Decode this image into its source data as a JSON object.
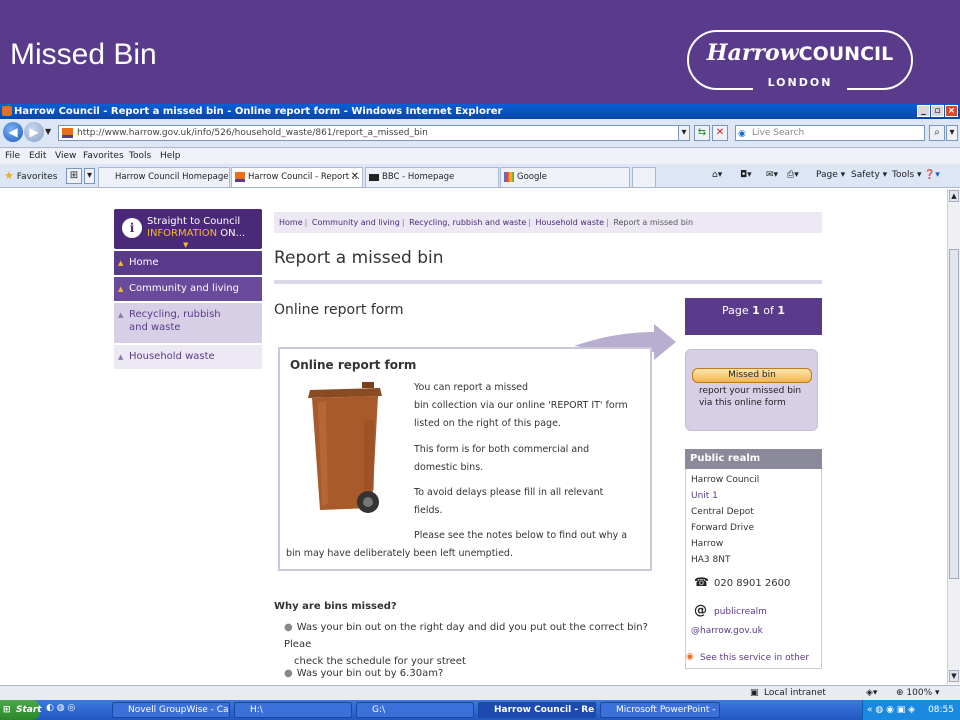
{
  "slide": {
    "title": "Missed Bin",
    "logo_main": "Harrow",
    "logo_council": "COUNCIL",
    "logo_sub": "LONDON"
  },
  "window": {
    "title": "Harrow Council - Report a missed bin - Online report form - Windows Internet Explorer"
  },
  "address_bar": {
    "url": "http://www.harrow.gov.uk/info/526/household_waste/861/report_a_missed_bin",
    "search_placeholder": "Live Search"
  },
  "menu": [
    "File",
    "Edit",
    "View",
    "Favorites",
    "Tools",
    "Help"
  ],
  "favorites_label": "Favorites",
  "tabs": [
    {
      "label": "Harrow Council Homepage"
    },
    {
      "label": "Harrow Council - Report ...",
      "active": true
    },
    {
      "label": "BBC - Homepage"
    },
    {
      "label": "Google"
    }
  ],
  "commands": {
    "page": "Page",
    "safety": "Safety",
    "tools": "Tools"
  },
  "sidebar": {
    "header_line1": "Straight to Council",
    "header_highlight": "INFORMATION",
    "header_line2_suffix": "ON...",
    "items": [
      {
        "label": "Home"
      },
      {
        "label": "Community and living"
      },
      {
        "label": "Recycling, rubbish and waste"
      },
      {
        "label": "Household waste"
      }
    ]
  },
  "breadcrumb": [
    "Home",
    "Community and living",
    "Recycling, rubbish and waste",
    "Household waste",
    "Report a missed bin"
  ],
  "page_title": "Report a missed bin",
  "section_title": "Online report form",
  "form_box": {
    "heading": "Online report form",
    "p1_line1": "You can report a missed",
    "p1_line2": "bin collection via our online 'REPORT IT' form",
    "p1_line3": "listed on the right of this page.",
    "p2_line1": "This form is for both commercial and",
    "p2_line2": "domestic bins.",
    "p3_line1": "To avoid delays please fill in all relevant",
    "p3_line2": "fields.",
    "p4_line1": "Please see the notes below to find out why a",
    "p4_line2": "bin may have deliberately been left unemptied."
  },
  "page_indicator": {
    "prefix": "Page",
    "current": "1",
    "of": "of",
    "total": "1"
  },
  "missed_bin": {
    "button": "Missed bin",
    "desc_line1": "report your missed bin",
    "desc_line2": "via this online form"
  },
  "public_realm": {
    "heading": "Public realm",
    "address": [
      "Harrow Council",
      "Unit 1",
      "Central Depot",
      "Forward Drive",
      "Harrow",
      "HA3 8NT"
    ],
    "phone": "020 8901 2600",
    "email_user": "publicrealm",
    "email_domain": "@harrow.gov.uk",
    "see_other": "See this service in other"
  },
  "why_missed": {
    "heading": "Why are bins missed?",
    "b1_line1": "Was your bin out on the right day and did you put out the correct bin? Pleae",
    "b1_line2": "check the schedule for your street",
    "b2": "Was your bin out by 6.30am?"
  },
  "status_bar": {
    "zone": "Local intranet",
    "zoom": "100%"
  },
  "taskbar": {
    "start": "Start",
    "items": [
      "Novell GroupWise - Cale...",
      "H:\\",
      "G:\\",
      "Harrow Council - Rep...",
      "Microsoft PowerPoint - [..."
    ],
    "clock": "08:55"
  },
  "colors": {
    "brand_purple": "#5a3a8a",
    "bin_brown": "#a85a2a",
    "accent_orange": "#f8b830"
  }
}
